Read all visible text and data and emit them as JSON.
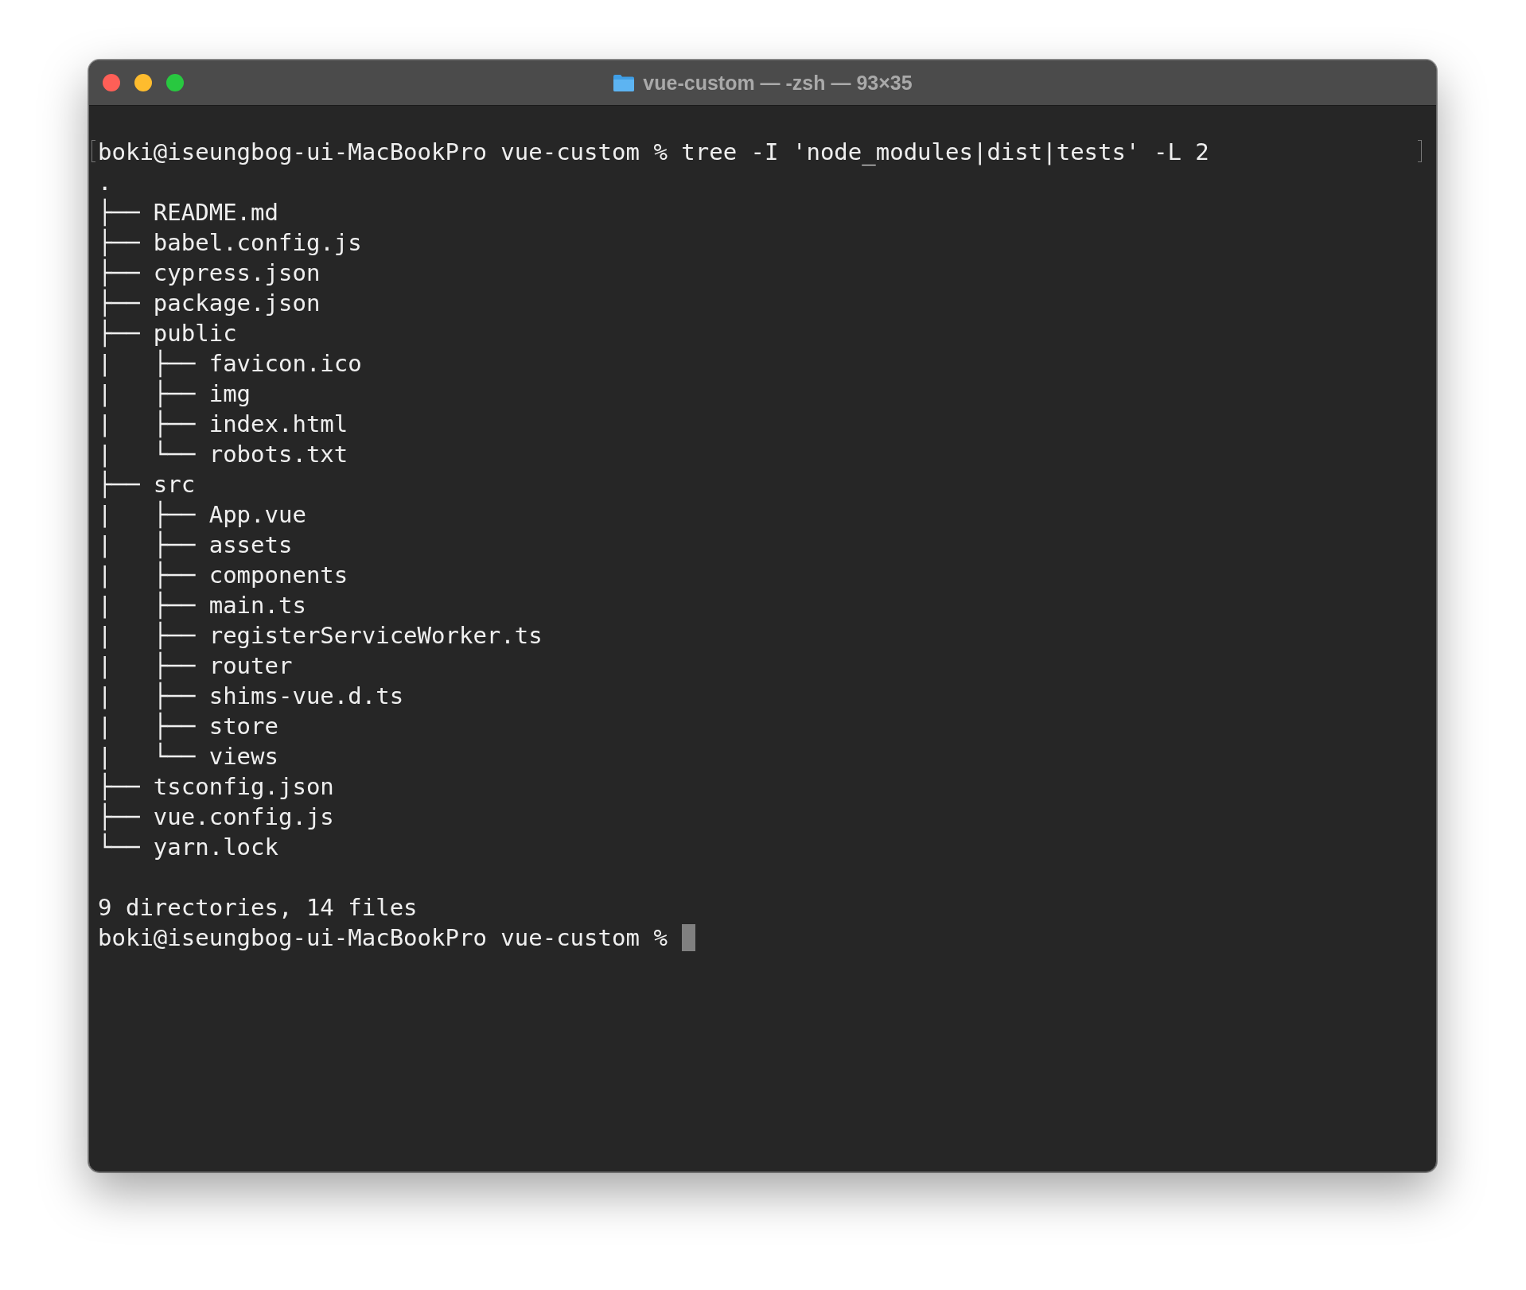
{
  "window": {
    "title": "vue-custom — -zsh — 93×35"
  },
  "terminal": {
    "lines": [
      {
        "kind": "command",
        "text": "boki@iseungbog-ui-MacBookPro vue-custom % tree -I 'node_modules|dist|tests' -L 2"
      },
      {
        "kind": "output",
        "text": "."
      },
      {
        "kind": "output",
        "text": "├── README.md"
      },
      {
        "kind": "output",
        "text": "├── babel.config.js"
      },
      {
        "kind": "output",
        "text": "├── cypress.json"
      },
      {
        "kind": "output",
        "text": "├── package.json"
      },
      {
        "kind": "output",
        "text": "├── public"
      },
      {
        "kind": "output",
        "text": "|   ├── favicon.ico"
      },
      {
        "kind": "output",
        "text": "|   ├── img"
      },
      {
        "kind": "output",
        "text": "|   ├── index.html"
      },
      {
        "kind": "output",
        "text": "|   └── robots.txt"
      },
      {
        "kind": "output",
        "text": "├── src"
      },
      {
        "kind": "output",
        "text": "|   ├── App.vue"
      },
      {
        "kind": "output",
        "text": "|   ├── assets"
      },
      {
        "kind": "output",
        "text": "|   ├── components"
      },
      {
        "kind": "output",
        "text": "|   ├── main.ts"
      },
      {
        "kind": "output",
        "text": "|   ├── registerServiceWorker.ts"
      },
      {
        "kind": "output",
        "text": "|   ├── router"
      },
      {
        "kind": "output",
        "text": "|   ├── shims-vue.d.ts"
      },
      {
        "kind": "output",
        "text": "|   ├── store"
      },
      {
        "kind": "output",
        "text": "|   └── views"
      },
      {
        "kind": "output",
        "text": "├── tsconfig.json"
      },
      {
        "kind": "output",
        "text": "├── vue.config.js"
      },
      {
        "kind": "output",
        "text": "└── yarn.lock"
      },
      {
        "kind": "blank"
      },
      {
        "kind": "output",
        "text": "9 directories, 14 files"
      },
      {
        "kind": "prompt",
        "text": "boki@iseungbog-ui-MacBookPro vue-custom %"
      }
    ]
  }
}
